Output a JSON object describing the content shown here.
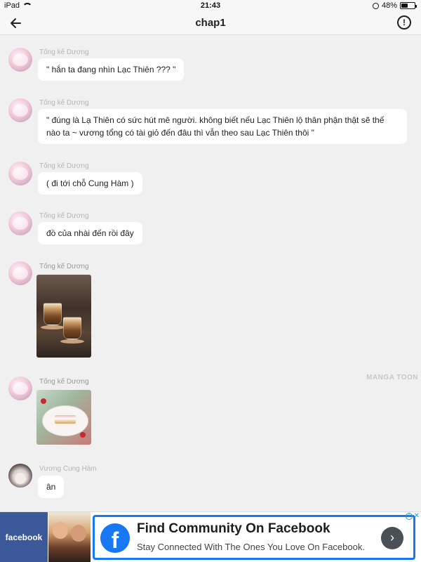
{
  "status_bar": {
    "device": "iPad",
    "time": "21:43",
    "battery": "48%",
    "battery_level": 0.48
  },
  "header": {
    "title": "chap1",
    "back_icon": "arrow-left-icon",
    "info_icon": "alert-circle-icon",
    "info_glyph": "!"
  },
  "messages": [
    {
      "sender": "Tống kế Dương",
      "text": "\" hắn ta đang nhìn Lạc Thiên ??? \""
    },
    {
      "sender": "Tống kế Dương",
      "text": "\" đúng là Lạ Thiên có sức hút mê người. không biết nếu Lạc Thiên lộ thân phận thật sẽ thế nào ta ~  vương tổng có tài giỏ đến đâu thì vẫn theo sau Lạc Thiên thôi \""
    },
    {
      "sender": "Tống kế Dương",
      "text": "( đi tới chỗ Cung Hàm )"
    },
    {
      "sender": "Tống kế Dương",
      "text": "đồ của nhài đến rồi đây"
    },
    {
      "sender": "Tống kế Dương",
      "image": "coffee-photo"
    },
    {
      "sender": "Tống kế Dương",
      "image": "cake-photo"
    },
    {
      "sender": "Vương Cung Hàm",
      "text": "ân"
    }
  ],
  "watermark": "MANGA TOON",
  "ad": {
    "brand": "facebook",
    "title": "Find Community On Facebook",
    "subtitle": "Stay Connected With The Ones You Love On Facebook.",
    "arrow_glyph": "›",
    "fb_glyph": "f",
    "info_glyph": "i",
    "close_glyph": "✕",
    "accent": "#1877f2"
  }
}
